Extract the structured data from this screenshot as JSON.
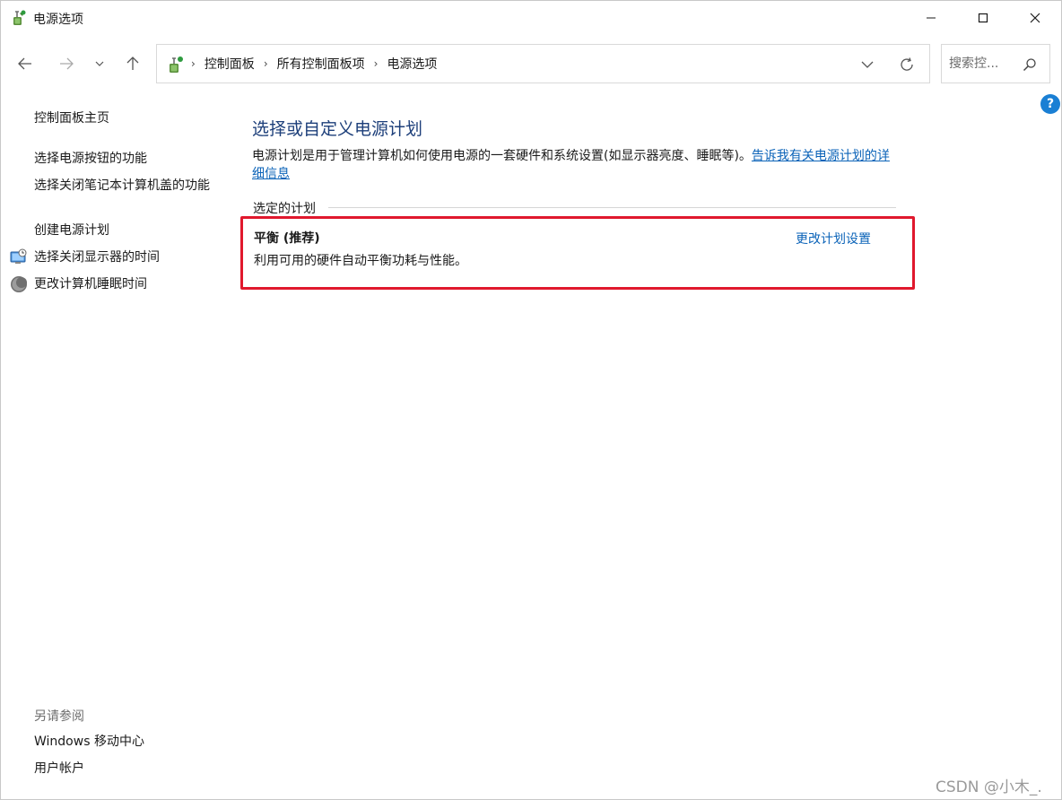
{
  "window": {
    "title": "电源选项",
    "minimize_icon": "minimize-icon",
    "maximize_icon": "maximize-icon",
    "close_icon": "close-icon"
  },
  "nav": {
    "breadcrumbs": [
      "控制面板",
      "所有控制面板项",
      "电源选项"
    ],
    "search_placeholder": "搜索控...",
    "icons": [
      "back-arrow-icon",
      "forward-arrow-icon",
      "chevron-down-icon",
      "up-arrow-icon",
      "refresh-icon",
      "search-icon",
      "help-icon"
    ]
  },
  "sidebar": {
    "home": "控制面板主页",
    "links": [
      {
        "label": "选择电源按钮的功能"
      },
      {
        "label": "选择关闭笔记本计算机盖的功能"
      },
      {
        "label": "创建电源计划"
      },
      {
        "label": "选择关闭显示器的时间",
        "icon": "monitor-clock-icon"
      },
      {
        "label": "更改计算机睡眠时间",
        "icon": "moon-icon"
      }
    ],
    "see_also_title": "另请参阅",
    "see_also": [
      {
        "label": "Windows 移动中心"
      },
      {
        "label": "用户帐户"
      }
    ]
  },
  "main": {
    "title": "选择或自定义电源计划",
    "description": "电源计划是用于管理计算机如何使用电源的一套硬件和系统设置(如显示器亮度、睡眠等)。",
    "description_link": "告诉我有关电源计划的详细信息",
    "section_label": "选定的计划",
    "plan": {
      "name": "平衡 (推荐)",
      "description": "利用可用的硬件自动平衡功耗与性能。",
      "change_link": "更改计划设置"
    }
  },
  "watermark": "CSDN @小木_.",
  "colors": {
    "title_blue": "#1d3f7a",
    "link_blue": "#0b63b8",
    "highlight_red": "#e0182d",
    "help_blue": "#1a7fd4"
  }
}
